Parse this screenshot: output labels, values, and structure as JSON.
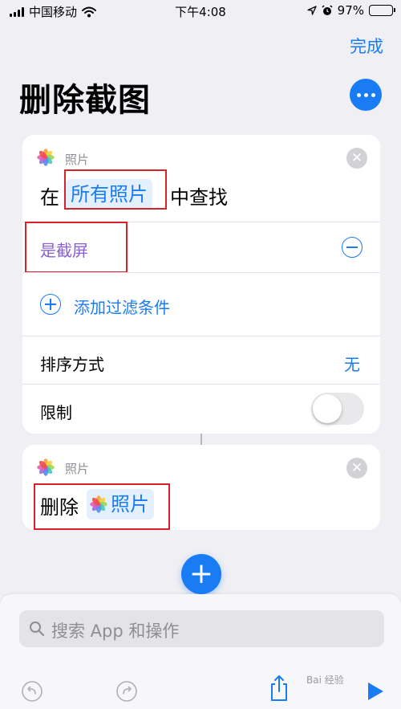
{
  "status_bar": {
    "carrier": "中国移动",
    "time": "下午4:08",
    "battery_percent": "97%",
    "battery_level": 0.97,
    "wifi_icon": "wifi-icon",
    "location_icon": "location-arrow-icon",
    "alarm_icon": "alarm-clock-icon"
  },
  "header": {
    "done_label": "完成",
    "title": "删除截图",
    "more_icon": "ellipsis-icon"
  },
  "card_find": {
    "app_label": "照片",
    "prefix": "在",
    "token": "所有照片",
    "suffix": "中查找",
    "filter_label": "是截屏",
    "add_filter_label": "添加过滤条件",
    "sort_label": "排序方式",
    "sort_value": "无",
    "limit_label": "限制",
    "limit_enabled": false
  },
  "card_delete": {
    "app_label": "照片",
    "prefix": "删除",
    "token": "照片"
  },
  "bottom_sheet": {
    "search_placeholder": "搜索 App 和操作"
  },
  "watermark": "Bai 经验",
  "colors": {
    "accent": "#1a7cf5",
    "highlight": "#d8222b",
    "background": "#efeff4",
    "card": "#ffffff"
  }
}
